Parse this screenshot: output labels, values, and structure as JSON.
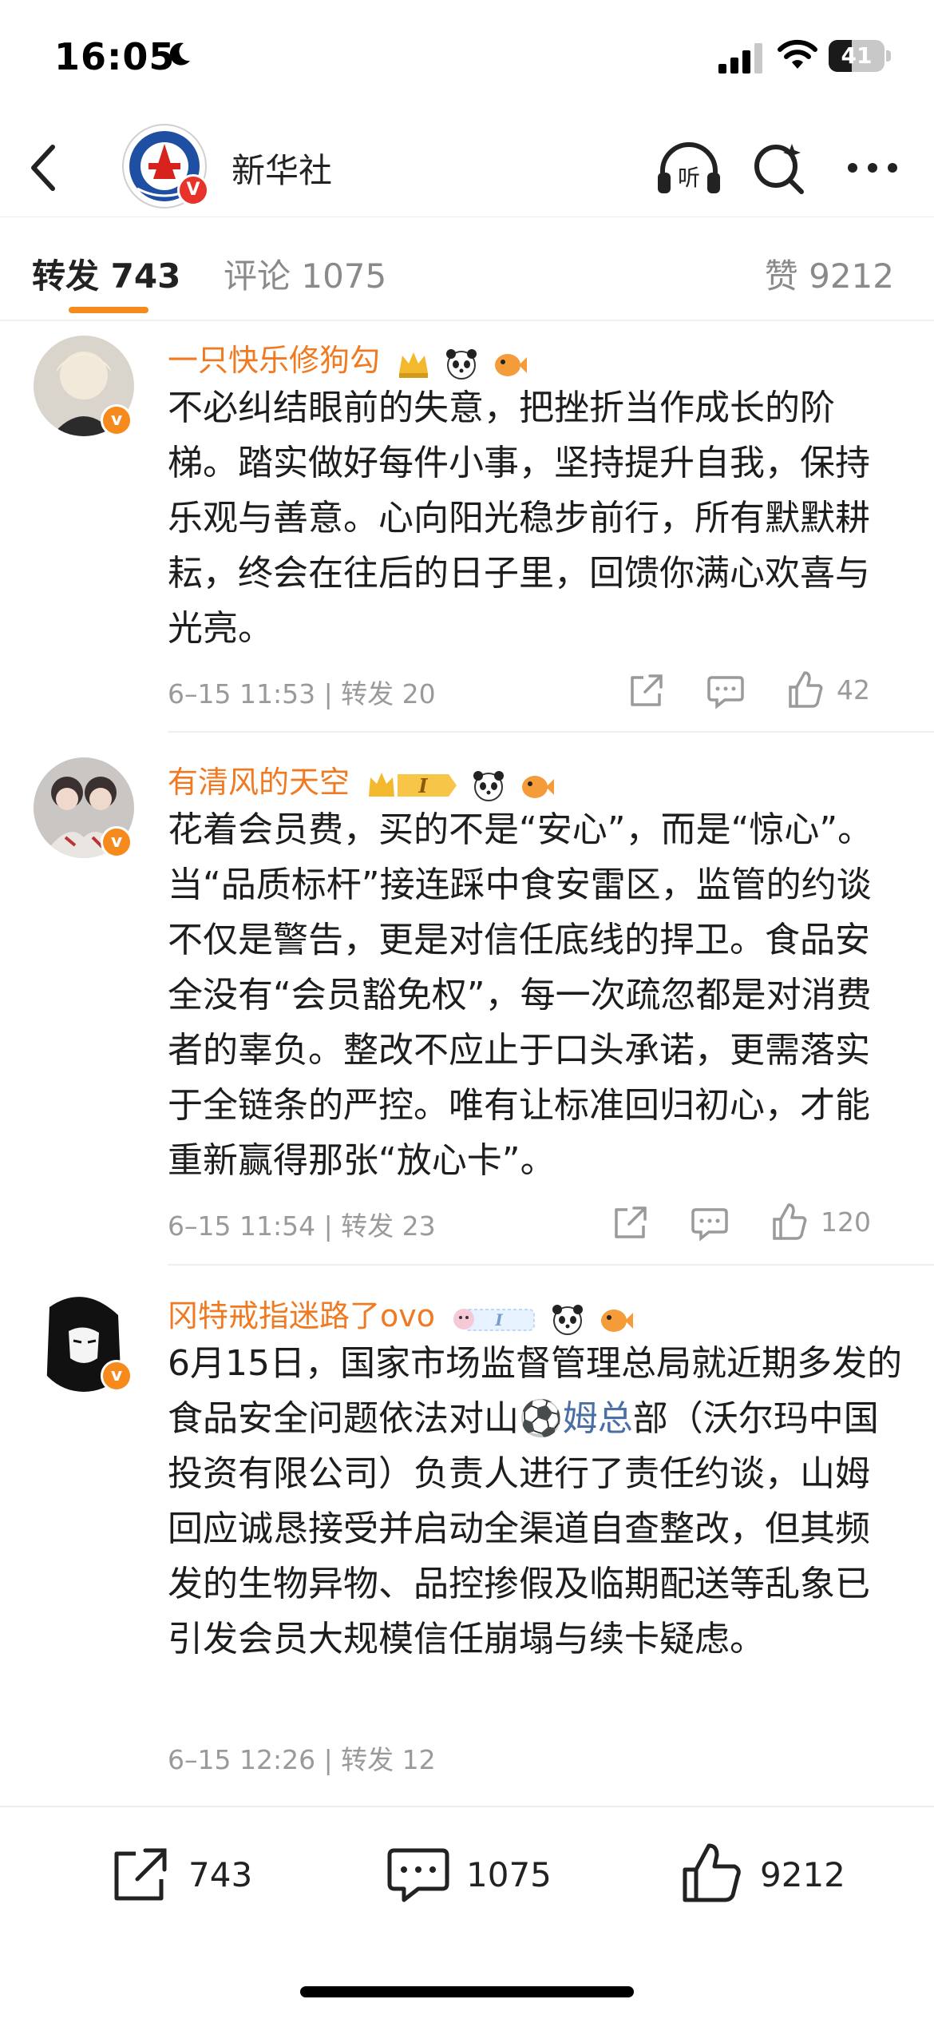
{
  "status_bar": {
    "time": "16:05",
    "battery": "41",
    "battery_level": 0.41
  },
  "header": {
    "title": "新华社",
    "back_icon": "chevron-left-icon",
    "listen_label": "听",
    "accent": "#f68a1c"
  },
  "tabs": {
    "repost": "转发 743",
    "comment": "评论 1075",
    "like": "赞 9212"
  },
  "posts": [
    {
      "username": "一只快乐修狗勾",
      "text": "不必纠结眼前的失意，把挫折当作成长的阶梯。踏实做好每件小事，坚持提升自我，保持乐观与善意。心向阳光稳步前行，所有默默耕耘，终会在往后的日子里，回馈你满心欢喜与光亮。",
      "meta": "6–15 11:53 | 转发 20",
      "likes": "42"
    },
    {
      "username": "有清风的天空",
      "text": "花着会员费，买的不是“安心”，而是“惊心”。当“品质标杆”接连踩中食安雷区，监管的约谈不仅是警告，更是对信任底线的捍卫。食品安全没有“会员豁免权”，每一次疏忽都是对消费者的辜负。整改不应止于口头承诺，更需落实于全链条的严控。唯有让标准回归初心，才能重新赢得那张“放心卡”。",
      "meta": "6–15 11:54 | 转发 23",
      "likes": "120"
    },
    {
      "username": "冈特戒指迷路了ovo",
      "text_before": "6月15日，国家市场监督管理总局就近期多发的食品安全问题依法对山",
      "text_link": "⚽姆总",
      "text_after": "部（沃尔玛中国投资有限公司）负责人进行了责任约谈，山姆回应诚恳接受并启动全渠道自查整改，但其频发的生物异物、品控掺假及临期配送等乱象已引发会员大规模信任崩塌与续卡疑虑。",
      "meta": "6–15 12:26 | 转发 12"
    }
  ],
  "bottom_bar": {
    "repost": "743",
    "comment": "1075",
    "like": "9212"
  }
}
